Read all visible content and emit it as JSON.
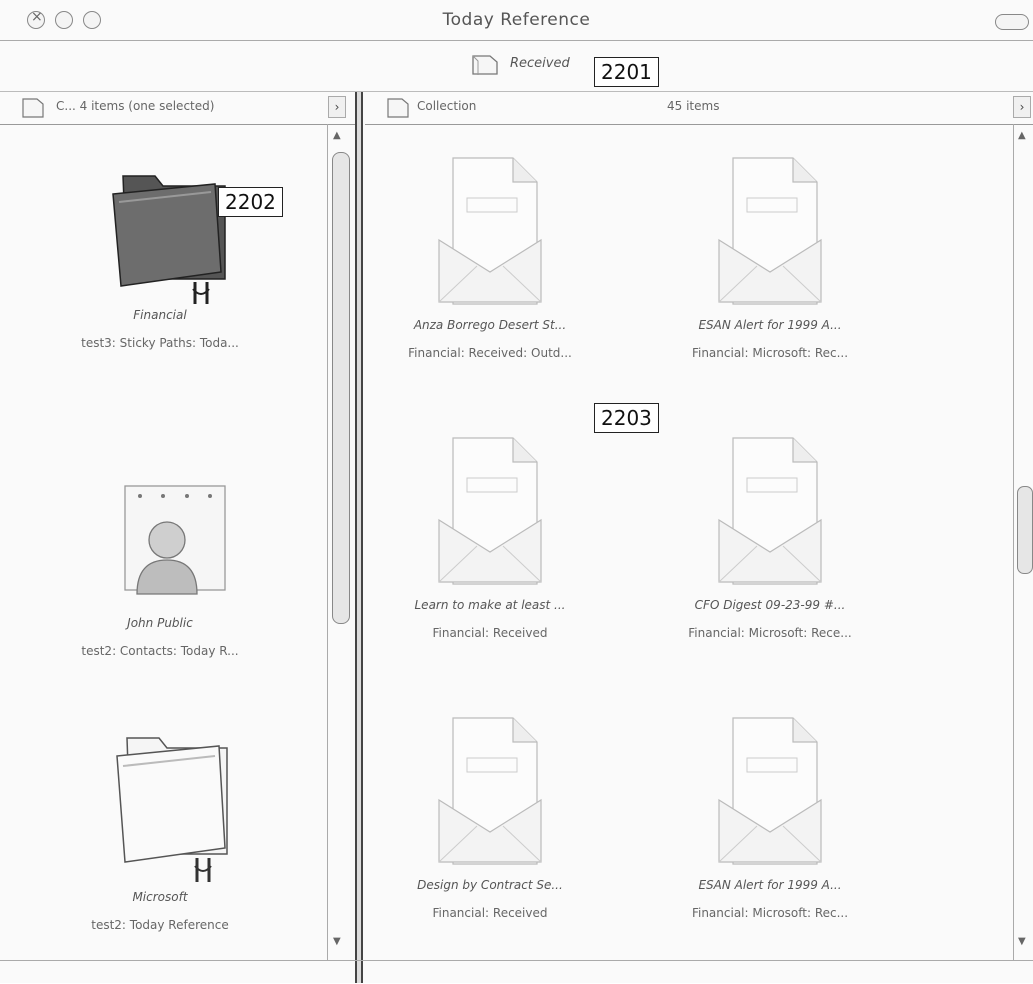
{
  "window": {
    "title": "Today Reference"
  },
  "pathbar": {
    "label": "Received"
  },
  "callouts": {
    "c2201": "2201",
    "c2202": "2202",
    "c2203": "2203"
  },
  "left_column": {
    "header": "C... 4 items (one selected)",
    "arrow": "›",
    "items": [
      {
        "name": "Financial",
        "path": "test3: Sticky Paths: Toda...",
        "icon": "folder-icon"
      },
      {
        "name": "John Public",
        "path": "test2: Contacts: Today R...",
        "icon": "contact-icon"
      },
      {
        "name": "Microsoft",
        "path": "test2: Today Reference",
        "icon": "folder-icon"
      }
    ]
  },
  "right_column": {
    "header": "Collection",
    "count": "45 items",
    "arrow": "›",
    "items": [
      {
        "name": "Anza Borrego Desert St...",
        "path": "Financial: Received: Outd...",
        "icon": "email-document-icon"
      },
      {
        "name": "ESAN Alert for 1999 A...",
        "path": "Financial: Microsoft: Rec...",
        "icon": "email-document-icon"
      },
      {
        "name": "Learn to make at least ...",
        "path": "Financial: Received",
        "icon": "email-document-icon"
      },
      {
        "name": "CFO Digest 09-23-99 #...",
        "path": "Financial: Microsoft: Rece...",
        "icon": "email-document-icon"
      },
      {
        "name": "Design by Contract Se...",
        "path": "Financial: Received",
        "icon": "email-document-icon"
      },
      {
        "name": "ESAN Alert for 1999 A...",
        "path": "Financial: Microsoft: Rec...",
        "icon": "email-document-icon"
      }
    ]
  }
}
